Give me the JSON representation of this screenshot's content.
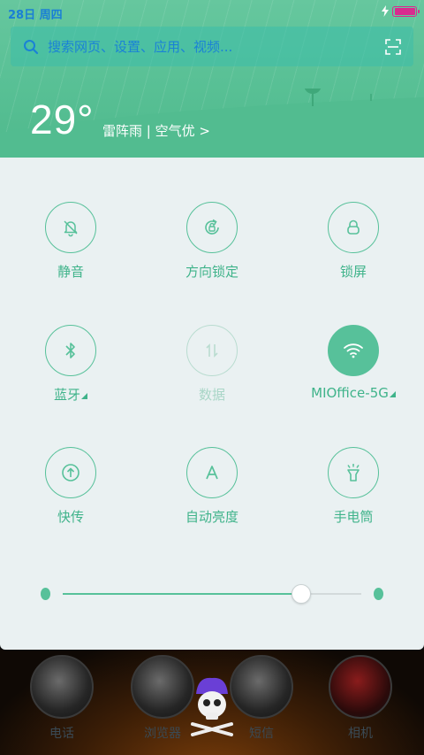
{
  "status": {
    "date": "28日",
    "weekday": "周四",
    "battery_level": 0.9
  },
  "search": {
    "placeholder": "搜索网页、设置、应用、视频..."
  },
  "weather": {
    "temp": "29°",
    "desc": "雷阵雨 | 空气优 >"
  },
  "tiles": [
    {
      "label": "静音",
      "icon": "bell-muted-icon",
      "state": "off"
    },
    {
      "label": "方向锁定",
      "icon": "rotation-lock-icon",
      "state": "off"
    },
    {
      "label": "锁屏",
      "icon": "lock-icon",
      "state": "off"
    },
    {
      "label": "蓝牙",
      "icon": "bluetooth-icon",
      "state": "off",
      "has_more": true
    },
    {
      "label": "数据",
      "icon": "mobile-data-icon",
      "state": "disabled"
    },
    {
      "label": "MIOffice-5G",
      "icon": "wifi-icon",
      "state": "on",
      "has_more": true
    },
    {
      "label": "快传",
      "icon": "share-upload-icon",
      "state": "off"
    },
    {
      "label": "自动亮度",
      "icon": "auto-brightness-icon",
      "state": "off"
    },
    {
      "label": "手电筒",
      "icon": "flashlight-icon",
      "state": "off"
    }
  ],
  "brightness": {
    "level": 0.8
  },
  "dock": {
    "apps": [
      "电话",
      "浏览器",
      "短信",
      "相机"
    ]
  },
  "colors": {
    "accent": "#57c19a",
    "header": "#5cc398",
    "panel": "#eaf1f2",
    "status_text": "#1a7fd6",
    "battery": "#d92b8f"
  }
}
